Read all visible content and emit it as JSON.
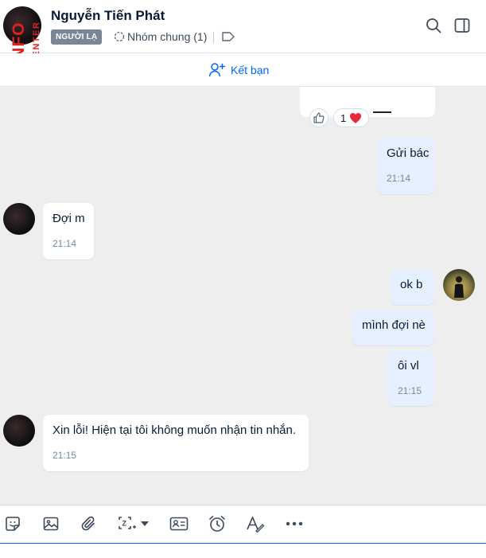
{
  "header": {
    "name": "Nguyễn Tiến Phát",
    "badge": "NGƯỜI LẠ",
    "group_label": "Nhóm chung (1)"
  },
  "watermark": {
    "brand": "CHECKSCAM.INFO",
    "subtitle": "DATA CENTER"
  },
  "friend_bar": {
    "label": "Kết bạn"
  },
  "reactions": {
    "count": "1"
  },
  "messages": [
    {
      "side": "me",
      "text": "Gửi bác",
      "time": "21:14"
    },
    {
      "side": "them",
      "text": "Đợi m",
      "time": "21:14"
    },
    {
      "side": "me",
      "text": "ok b",
      "time": ""
    },
    {
      "side": "me",
      "text": "mình đợi nè",
      "time": ""
    },
    {
      "side": "me",
      "text": "ôi vl",
      "time": "21:15"
    },
    {
      "side": "them",
      "text": "Xin lỗi! Hiện tại tôi không muốn nhận tin nhắn.",
      "time": "21:15"
    }
  ],
  "colors": {
    "accent": "#0068ff",
    "my_bubble": "#e5efff",
    "their_bubble": "#ffffff",
    "badge": "#7a8595",
    "watermark": "#e0201c"
  },
  "toolbar_icons": [
    "sticker-icon",
    "image-icon",
    "attachment-icon",
    "screenshot-icon",
    "contact-card-icon",
    "reminder-icon",
    "text-format-icon",
    "more-icon"
  ]
}
